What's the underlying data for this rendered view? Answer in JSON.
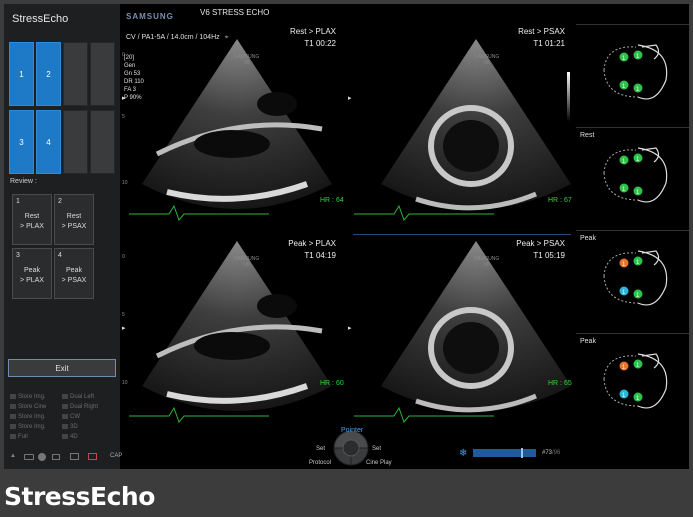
{
  "app": {
    "title": "StressEcho"
  },
  "header": {
    "brand": "SAMSUNG",
    "title": "V6 STRESS ECHO",
    "preset": "CV / PA1-5A / 14.0cm / 104Hz"
  },
  "params": [
    "[20]",
    "Gen",
    "Gn   53",
    "DR   110",
    "FA   3",
    "P    90%"
  ],
  "quad_grid": [
    {
      "label": "1",
      "active": true
    },
    {
      "label": "2",
      "active": true
    },
    {
      "label": "",
      "active": false
    },
    {
      "label": "",
      "active": false
    },
    {
      "label": "3",
      "active": true
    },
    {
      "label": "4",
      "active": true
    },
    {
      "label": "",
      "active": false
    },
    {
      "label": "",
      "active": false
    }
  ],
  "review": {
    "label": "Review :",
    "cells": [
      {
        "num": "1",
        "line1": "Rest",
        "line2": "> PLAX"
      },
      {
        "num": "2",
        "line1": "Rest",
        "line2": "> PSAX"
      },
      {
        "num": "3",
        "line1": "Peak",
        "line2": "> PLAX"
      },
      {
        "num": "4",
        "line1": "Peak",
        "line2": "> PSAX"
      }
    ]
  },
  "exit_label": "Exit",
  "options": [
    {
      "label": "Store Img.",
      "col": 0,
      "row": 0
    },
    {
      "label": "Dual Left",
      "col": 1,
      "row": 0
    },
    {
      "label": "Store Cine",
      "col": 0,
      "row": 1
    },
    {
      "label": "Dual Right",
      "col": 1,
      "row": 1
    },
    {
      "label": "Store Img.",
      "col": 0,
      "row": 2
    },
    {
      "label": "CW",
      "col": 1,
      "row": 2
    },
    {
      "label": "Store Img.",
      "col": 0,
      "row": 3
    },
    {
      "label": "3D",
      "col": 1,
      "row": 3
    },
    {
      "label": "Full",
      "col": 0,
      "row": 4
    },
    {
      "label": "4D",
      "col": 1,
      "row": 4
    }
  ],
  "bottom_icons": {
    "arrow": "▲",
    "cap": "CAP"
  },
  "viewports": [
    {
      "line1": "Rest > PLAX",
      "line2": "T1  00:22",
      "hr": "HR : 64",
      "brand": "SAMSUNG",
      "brand2": "V6"
    },
    {
      "line1": "Rest > PSAX",
      "line2": "T1  01:21",
      "hr": "HR : 67",
      "brand": "SAMSUNG",
      "brand2": "V6"
    },
    {
      "line1": "Peak > PLAX",
      "line2": "T1  04:19",
      "hr": "HR : 60",
      "brand": "SAMSUNG",
      "brand2": "V6"
    },
    {
      "line1": "Peak > PSAX",
      "line2": "T1  05:19",
      "hr": "HR : 65",
      "brand": "SAMSUNG",
      "brand2": "V6"
    }
  ],
  "rulers": [
    "0",
    "5",
    "10",
    "0",
    "5",
    "10"
  ],
  "schematics": [
    {
      "label": ""
    },
    {
      "label": "Rest"
    },
    {
      "label": "Peak"
    },
    {
      "label": "Peak"
    }
  ],
  "controls": {
    "pointer": "Pointer",
    "set_left": "Set",
    "set_right": "Set",
    "protocol": "Protocol",
    "cine_play": "Cine Play",
    "frame": "#73",
    "frame_total": "/96"
  },
  "progress_fraction": 0.76,
  "caption": "StressEcho",
  "colors": {
    "accent": "#1e79c6",
    "hr_green": "#34d43e",
    "segment_green": "#2fc24a",
    "segment_orange": "#e8742a",
    "segment_cyan": "#2ab6d8"
  }
}
